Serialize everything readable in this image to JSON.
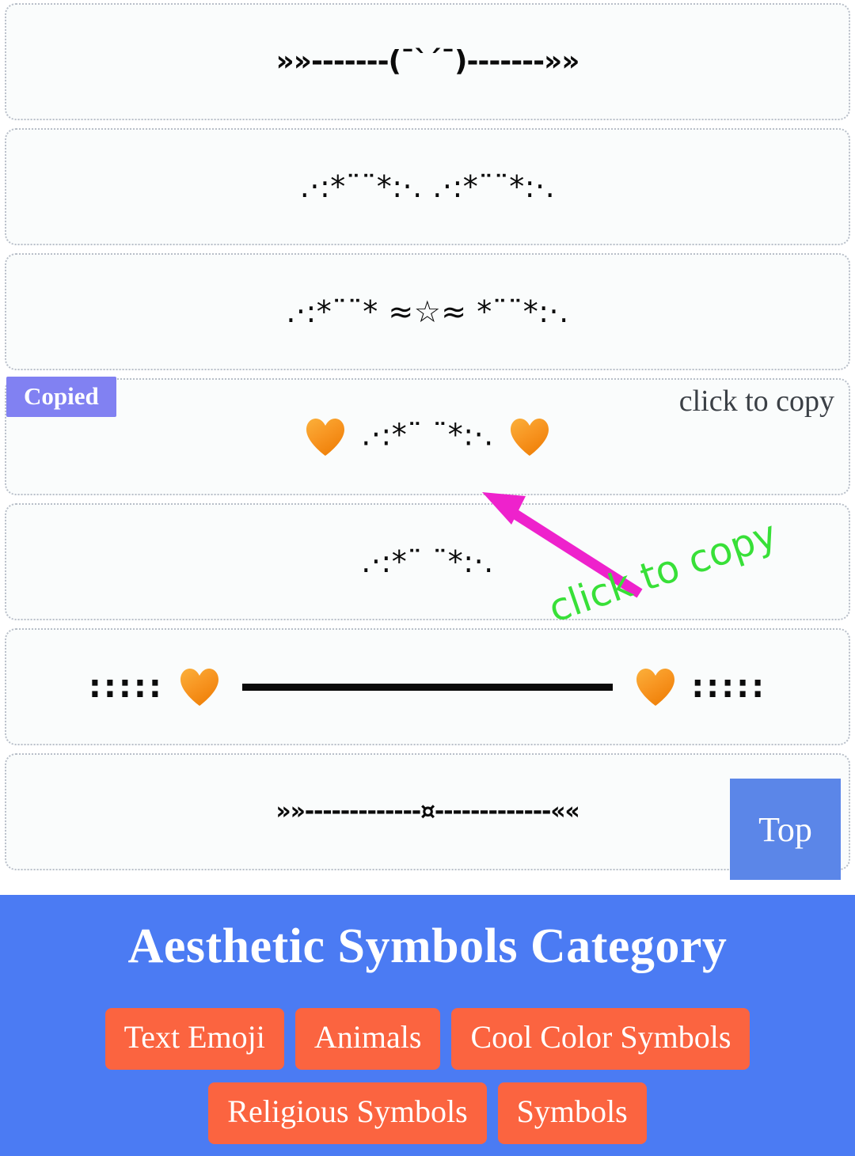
{
  "page": {
    "background": "#ffffff",
    "accent_blue": "#4b7bf3",
    "accent_coral": "#fb6440",
    "badge_purple": "#8181f2",
    "annotation_green": "#38e038",
    "annotation_magenta": "#ee22cc"
  },
  "hints": {
    "click_to_copy": "click to copy",
    "copied_badge": "Copied",
    "annotation_click_to_copy": "click to copy"
  },
  "symbol_cards": [
    {
      "id": "card-1",
      "text": "»»-------(¯`´¯)-------»»",
      "style": "kao"
    },
    {
      "id": "card-2",
      "text": ".·:*¨¨*:·. .·:*¨¨*:·.",
      "style": "big"
    },
    {
      "id": "card-3",
      "text": ".·:*¨¨* ≈☆≈ *¨¨*:·.",
      "style": "big"
    },
    {
      "id": "card-4",
      "text": "🧡 .·:*¨ ¨*:·. 🧡",
      "style": "big",
      "has_hearts": true,
      "inner": ".·:*¨ ¨*:·."
    },
    {
      "id": "card-5",
      "text": ".·:*¨ ¨*:·.",
      "style": "big"
    },
    {
      "id": "card-6",
      "text": ":::::🧡▬▬▬▬▬▬▬🧡:::::",
      "style": "big",
      "colons": ":::::"
    },
    {
      "id": "card-7",
      "text": "»»-------------¤-------------««",
      "style": "line"
    }
  ],
  "top_button": {
    "label": "Top"
  },
  "footer": {
    "title": "Aesthetic Symbols Category",
    "categories_row1": [
      {
        "label": "Text Emoji"
      },
      {
        "label": "Animals"
      },
      {
        "label": "Cool Color Symbols"
      }
    ],
    "categories_row2": [
      {
        "label": "Religious Symbols"
      },
      {
        "label": "Symbols"
      }
    ]
  }
}
